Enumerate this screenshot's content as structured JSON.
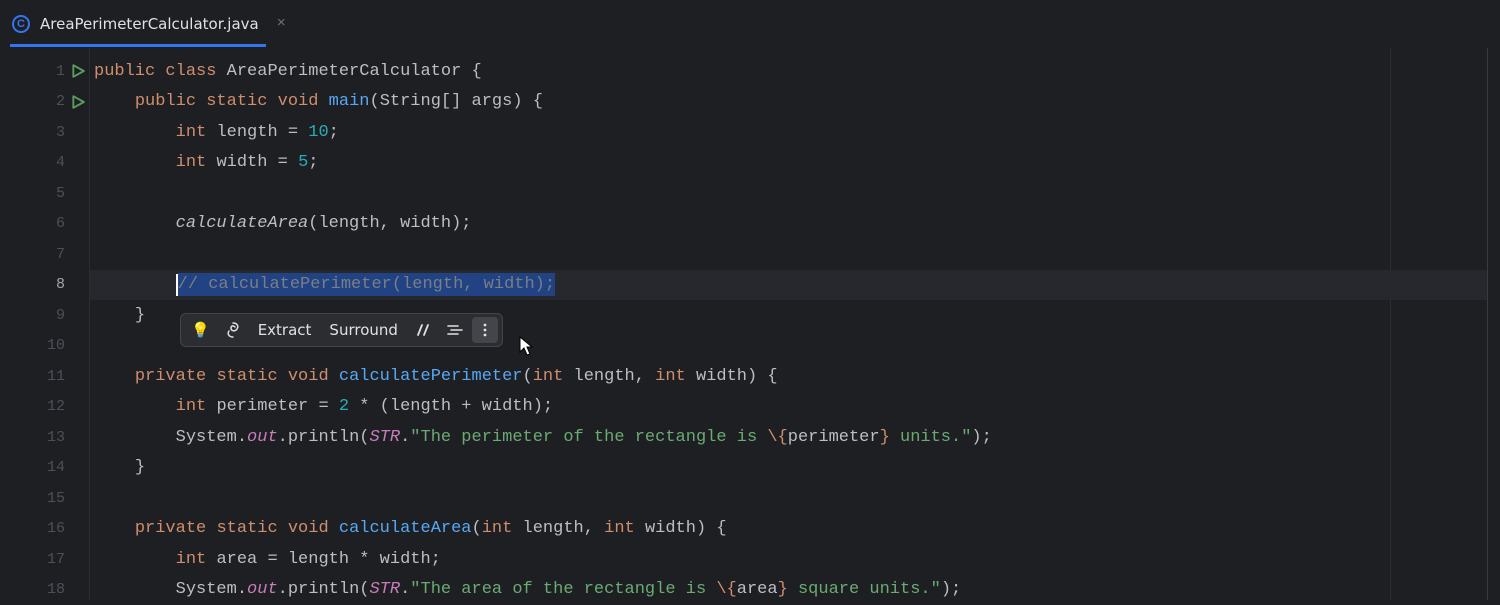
{
  "tab": {
    "title": "AreaPerimeterCalculator.java",
    "icon_letter": "C"
  },
  "current_line": 8,
  "run_markers": [
    1,
    2
  ],
  "lines": [
    {
      "n": 1,
      "tokens": [
        {
          "t": "public ",
          "c": "kw"
        },
        {
          "t": "class ",
          "c": "kw"
        },
        {
          "t": "AreaPerimeterCalculator ",
          "c": "cls"
        },
        {
          "t": "{",
          "c": "p"
        }
      ]
    },
    {
      "n": 2,
      "indent": 1,
      "tokens": [
        {
          "t": "public ",
          "c": "kw"
        },
        {
          "t": "static ",
          "c": "kw"
        },
        {
          "t": "void ",
          "c": "kw"
        },
        {
          "t": "main",
          "c": "fn"
        },
        {
          "t": "(",
          "c": "p"
        },
        {
          "t": "String",
          "c": "cls"
        },
        {
          "t": "[] args) {",
          "c": "p"
        }
      ]
    },
    {
      "n": 3,
      "indent": 2,
      "tokens": [
        {
          "t": "int ",
          "c": "kw"
        },
        {
          "t": "length = ",
          "c": "p"
        },
        {
          "t": "10",
          "c": "num"
        },
        {
          "t": ";",
          "c": "p"
        }
      ]
    },
    {
      "n": 4,
      "indent": 2,
      "tokens": [
        {
          "t": "int ",
          "c": "kw"
        },
        {
          "t": "width = ",
          "c": "p"
        },
        {
          "t": "5",
          "c": "num"
        },
        {
          "t": ";",
          "c": "p"
        }
      ]
    },
    {
      "n": 5,
      "tokens": []
    },
    {
      "n": 6,
      "indent": 2,
      "tokens": [
        {
          "t": "calculateArea",
          "c": "fni"
        },
        {
          "t": "(length, width);",
          "c": "p"
        }
      ]
    },
    {
      "n": 7,
      "tokens": []
    },
    {
      "n": 8,
      "indent": 2,
      "selected": true,
      "tokens": [
        {
          "t": "// calculatePerimeter(length, width);",
          "c": "cm"
        }
      ]
    },
    {
      "n": 9,
      "indent": 1,
      "tokens": [
        {
          "t": "}",
          "c": "p"
        }
      ]
    },
    {
      "n": 10,
      "tokens": []
    },
    {
      "n": 11,
      "indent": 1,
      "tokens": [
        {
          "t": "private ",
          "c": "kw"
        },
        {
          "t": "static ",
          "c": "kw"
        },
        {
          "t": "void ",
          "c": "kw"
        },
        {
          "t": "calculatePerimeter",
          "c": "fn"
        },
        {
          "t": "(",
          "c": "p"
        },
        {
          "t": "int ",
          "c": "kw"
        },
        {
          "t": "length, ",
          "c": "p"
        },
        {
          "t": "int ",
          "c": "kw"
        },
        {
          "t": "width) {",
          "c": "p"
        }
      ]
    },
    {
      "n": 12,
      "indent": 2,
      "tokens": [
        {
          "t": "int ",
          "c": "kw"
        },
        {
          "t": "perimeter = ",
          "c": "p"
        },
        {
          "t": "2",
          "c": "num"
        },
        {
          "t": " * (length + width);",
          "c": "p"
        }
      ]
    },
    {
      "n": 13,
      "indent": 2,
      "tokens": [
        {
          "t": "System.",
          "c": "p"
        },
        {
          "t": "out",
          "c": "fld"
        },
        {
          "t": ".println(",
          "c": "p"
        },
        {
          "t": "STR",
          "c": "fld"
        },
        {
          "t": ".",
          "c": "p"
        },
        {
          "t": "\"The perimeter of the rectangle is ",
          "c": "str"
        },
        {
          "t": "\\{",
          "c": "tpl"
        },
        {
          "t": "perimeter",
          "c": "p"
        },
        {
          "t": "}",
          "c": "tpl"
        },
        {
          "t": " units.\"",
          "c": "str"
        },
        {
          "t": ");",
          "c": "p"
        }
      ]
    },
    {
      "n": 14,
      "indent": 1,
      "tokens": [
        {
          "t": "}",
          "c": "p"
        }
      ]
    },
    {
      "n": 15,
      "tokens": []
    },
    {
      "n": 16,
      "indent": 1,
      "tokens": [
        {
          "t": "private ",
          "c": "kw"
        },
        {
          "t": "static ",
          "c": "kw"
        },
        {
          "t": "void ",
          "c": "kw"
        },
        {
          "t": "calculateArea",
          "c": "fn"
        },
        {
          "t": "(",
          "c": "p"
        },
        {
          "t": "int ",
          "c": "kw"
        },
        {
          "t": "length, ",
          "c": "p"
        },
        {
          "t": "int ",
          "c": "kw"
        },
        {
          "t": "width) {",
          "c": "p"
        }
      ]
    },
    {
      "n": 17,
      "indent": 2,
      "tokens": [
        {
          "t": "int ",
          "c": "kw"
        },
        {
          "t": "area = length * width;",
          "c": "p"
        }
      ]
    },
    {
      "n": 18,
      "indent": 2,
      "tokens": [
        {
          "t": "System.",
          "c": "p"
        },
        {
          "t": "out",
          "c": "fld"
        },
        {
          "t": ".println(",
          "c": "p"
        },
        {
          "t": "STR",
          "c": "fld"
        },
        {
          "t": ".",
          "c": "p"
        },
        {
          "t": "\"The area of the rectangle is ",
          "c": "str"
        },
        {
          "t": "\\{",
          "c": "tpl"
        },
        {
          "t": "area",
          "c": "p"
        },
        {
          "t": "}",
          "c": "tpl"
        },
        {
          "t": " square units.\"",
          "c": "str"
        },
        {
          "t": ");",
          "c": "p"
        }
      ]
    }
  ],
  "toolbar": {
    "extract_label": "Extract",
    "surround_label": "Surround"
  }
}
